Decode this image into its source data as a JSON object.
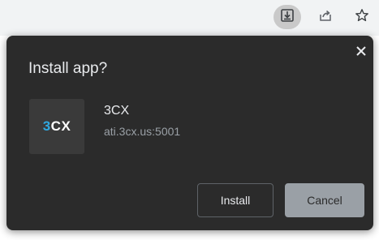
{
  "toolbar": {
    "install_icon": "install-app-icon",
    "share_icon": "share-icon",
    "bookmark_icon": "star-icon"
  },
  "dialog": {
    "title": "Install app?",
    "close_icon": "close-icon",
    "app": {
      "logo_number": "3",
      "logo_text": "CX",
      "name": "3CX",
      "url": "ati.3cx.us:5001"
    },
    "install_label": "Install",
    "cancel_label": "Cancel"
  },
  "colors": {
    "dialog_bg": "#2b2b2b",
    "logo_accent": "#2fa8e0",
    "cancel_bg": "#9aa0a6"
  }
}
